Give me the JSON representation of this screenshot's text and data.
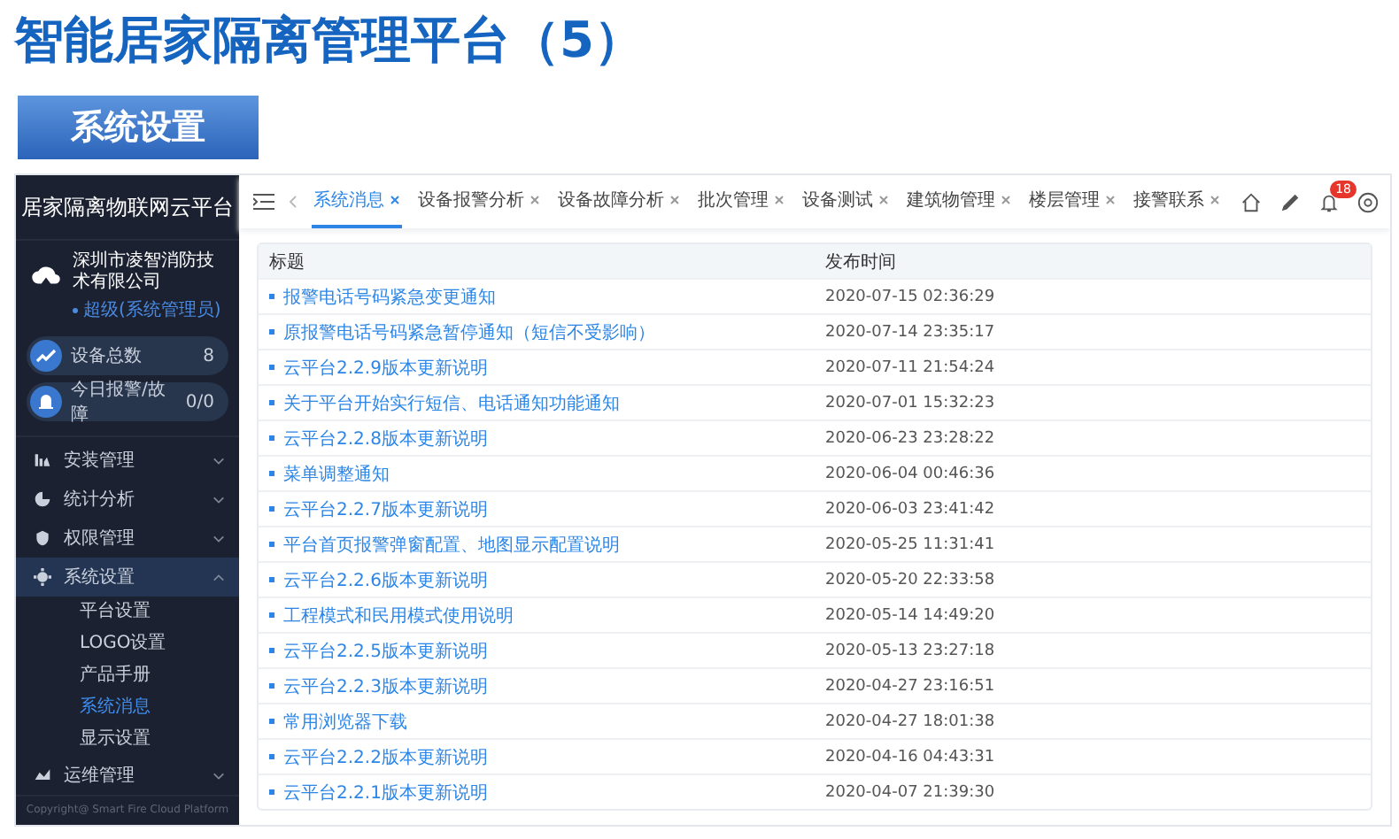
{
  "slide_title": "智能居家隔离管理平台（5）",
  "section_label": "系统设置",
  "sidebar": {
    "title": "居家隔离物联网云平台",
    "company": "深圳市凌智消防技术有限公司",
    "role": "超级(系统管理员)",
    "stats": [
      {
        "kind": "devices",
        "label": "设备总数",
        "value": "8"
      },
      {
        "kind": "alarms",
        "label": "今日报警/故障",
        "value": "0/0"
      }
    ],
    "menu": [
      {
        "kind": "install",
        "label": "安装管理",
        "expanded": false,
        "selected": false
      },
      {
        "kind": "stats",
        "label": "统计分析",
        "expanded": false,
        "selected": false
      },
      {
        "kind": "permission",
        "label": "权限管理",
        "expanded": false,
        "selected": false
      },
      {
        "kind": "settings",
        "label": "系统设置",
        "expanded": true,
        "selected": true,
        "children": [
          {
            "label": "平台设置",
            "selected": false
          },
          {
            "label": "LOGO设置",
            "selected": false
          },
          {
            "label": "产品手册",
            "selected": false
          },
          {
            "label": "系统消息",
            "selected": true
          },
          {
            "label": "显示设置",
            "selected": false
          }
        ]
      },
      {
        "kind": "ops",
        "label": "运维管理",
        "expanded": false,
        "selected": false
      }
    ],
    "copyright": "Copyright@ Smart Fire Cloud Platform"
  },
  "tabs": [
    {
      "label": "系统消息",
      "selected": true
    },
    {
      "label": "设备报警分析",
      "selected": false
    },
    {
      "label": "设备故障分析",
      "selected": false
    },
    {
      "label": "批次管理",
      "selected": false
    },
    {
      "label": "设备测试",
      "selected": false
    },
    {
      "label": "建筑物管理",
      "selected": false
    },
    {
      "label": "楼层管理",
      "selected": false
    },
    {
      "label": "接警联系",
      "selected": false
    }
  ],
  "notification_count": "18",
  "table": {
    "columns": [
      "标题",
      "发布时间"
    ],
    "rows": [
      {
        "title": "报警电话号码紧急变更通知",
        "time": "2020-07-15 02:36:29"
      },
      {
        "title": "原报警电话号码紧急暂停通知（短信不受影响）",
        "time": "2020-07-14 23:35:17"
      },
      {
        "title": "云平台2.2.9版本更新说明",
        "time": "2020-07-11 21:54:24"
      },
      {
        "title": "关于平台开始实行短信、电话通知功能通知",
        "time": "2020-07-01 15:32:23"
      },
      {
        "title": "云平台2.2.8版本更新说明",
        "time": "2020-06-23 23:28:22"
      },
      {
        "title": "菜单调整通知",
        "time": "2020-06-04 00:46:36"
      },
      {
        "title": "云平台2.2.7版本更新说明",
        "time": "2020-06-03 23:41:42"
      },
      {
        "title": "平台首页报警弹窗配置、地图显示配置说明",
        "time": "2020-05-25 11:31:41"
      },
      {
        "title": "云平台2.2.6版本更新说明",
        "time": "2020-05-20 22:33:58"
      },
      {
        "title": "工程模式和民用模式使用说明",
        "time": "2020-05-14 14:49:20"
      },
      {
        "title": "云平台2.2.5版本更新说明",
        "time": "2020-05-13 23:27:18"
      },
      {
        "title": "云平台2.2.3版本更新说明",
        "time": "2020-04-27 23:16:51"
      },
      {
        "title": "常用浏览器下载",
        "time": "2020-04-27 18:01:38"
      },
      {
        "title": "云平台2.2.2版本更新说明",
        "time": "2020-04-16 04:43:31"
      },
      {
        "title": "云平台2.2.1版本更新说明",
        "time": "2020-04-07 21:39:30"
      }
    ]
  }
}
